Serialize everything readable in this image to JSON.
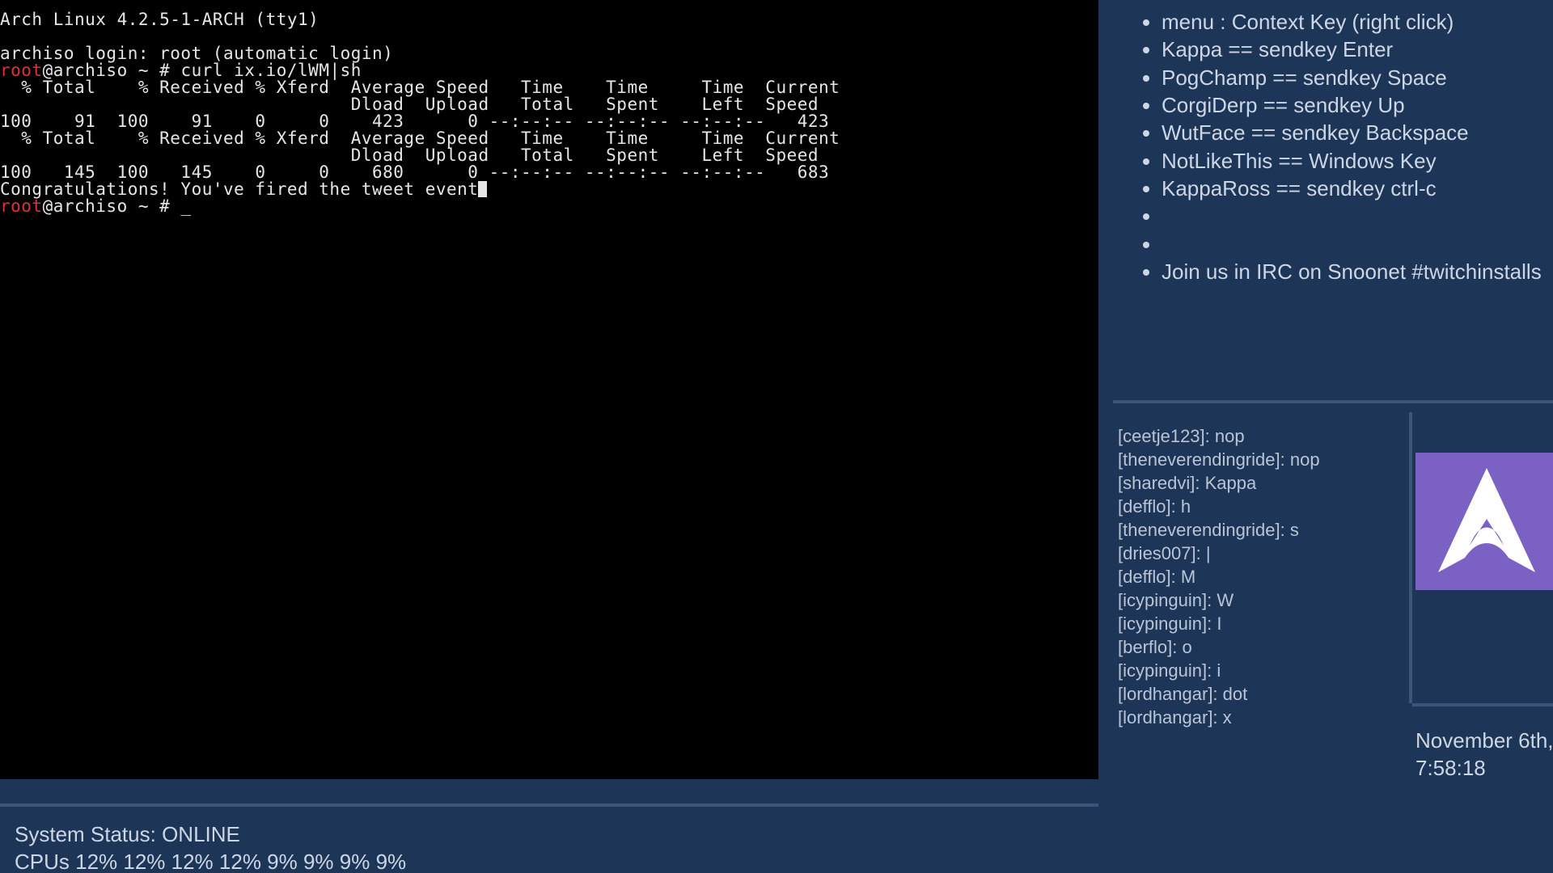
{
  "terminal": {
    "header": "Arch Linux 4.2.5-1-ARCH (tty1)",
    "login_line": "archiso login: root (automatic login)",
    "prompt_user": "root",
    "prompt_rest": "@archiso ~ # ",
    "command1": "curl ix.io/lWM|sh",
    "curl_header1": "  % Total    % Received % Xferd  Average Speed   Time    Time     Time  Current",
    "curl_header2": "                                 Dload  Upload   Total   Spent    Left  Speed",
    "curl_row1": "100    91  100    91    0     0    423      0 --:--:-- --:--:-- --:--:--   423",
    "curl_header3": "  % Total    % Received % Xferd  Average Speed   Time    Time     Time  Current",
    "curl_header4": "                                 Dload  Upload   Total   Spent    Left  Speed",
    "curl_row2": "100   145  100   145    0     0    680      0 --:--:-- --:--:-- --:--:--   683",
    "congrats": "Congratulations! You've fired the tweet event",
    "prompt2_user": "root",
    "prompt2_rest": "@archiso ~ # "
  },
  "help": {
    "items": [
      "menu : Context Key (right click)",
      "Kappa == sendkey Enter",
      "PogChamp == sendkey Space",
      "CorgiDerp == sendkey Up",
      "WutFace == sendkey Backspace",
      "NotLikeThis == Windows Key",
      "KappaRoss == sendkey ctrl-c",
      "",
      "",
      "Join us in IRC on Snoonet #twitchinstalls"
    ]
  },
  "chat": {
    "lines": [
      {
        "user": "ceetje123",
        "msg": "nop"
      },
      {
        "user": "theneverendingride",
        "msg": "nop"
      },
      {
        "user": "sharedvi",
        "msg": "Kappa"
      },
      {
        "user": "defflo",
        "msg": "h"
      },
      {
        "user": "theneverendingride",
        "msg": "s"
      },
      {
        "user": "dries007",
        "msg": "|"
      },
      {
        "user": "defflo",
        "msg": "M"
      },
      {
        "user": "icypinguin",
        "msg": "W"
      },
      {
        "user": "icypinguin",
        "msg": "I"
      },
      {
        "user": "berflo",
        "msg": "o"
      },
      {
        "user": "icypinguin",
        "msg": "i"
      },
      {
        "user": "lordhangar",
        "msg": "dot"
      },
      {
        "user": "lordhangar",
        "msg": "x"
      }
    ]
  },
  "clock": {
    "date": "November 6th,",
    "time": "7:58:18"
  },
  "status": {
    "line1": "System Status: ONLINE",
    "line2": "CPUs 12% 12% 12% 12% 9% 9% 9% 9%"
  }
}
